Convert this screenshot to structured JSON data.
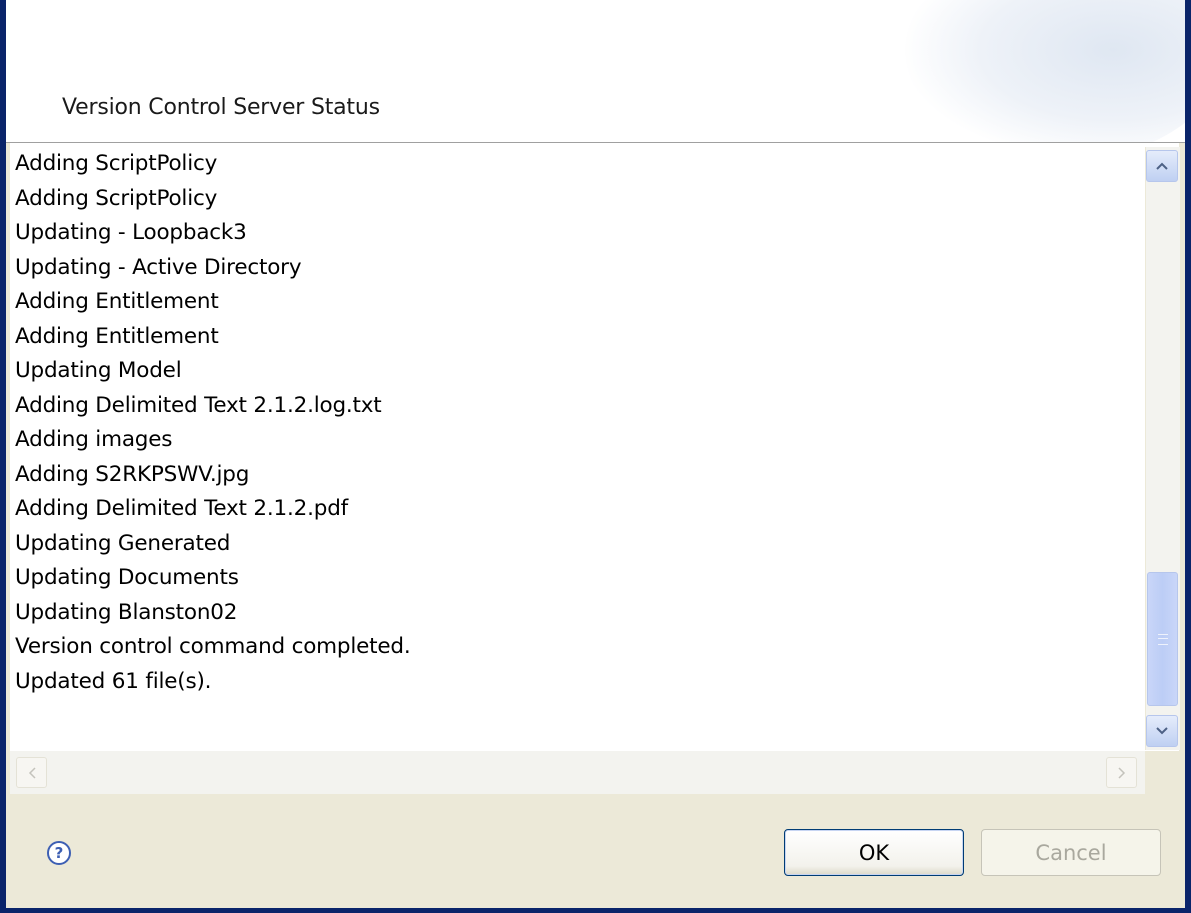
{
  "header": {
    "title": "Version Control Server Status"
  },
  "log": {
    "lines": [
      "Adding ScriptPolicy",
      "Adding ScriptPolicy",
      "Updating  - Loopback3",
      "Updating  - Active Directory",
      "Adding Entitlement",
      "Adding Entitlement",
      "Updating Model",
      "Adding Delimited Text 2.1.2.log.txt",
      "Adding images",
      "Adding S2RKPSWV.jpg",
      "Adding Delimited Text 2.1.2.pdf",
      "Updating Generated",
      "Updating Documents",
      "Updating Blanston02",
      "Version control command completed.",
      "Updated 61 file(s)."
    ]
  },
  "scrollbars": {
    "vertical_position": 1.0,
    "up_icon": "chevron-up-icon",
    "down_icon": "chevron-down-icon",
    "left_icon": "chevron-left-icon",
    "right_icon": "chevron-right-icon"
  },
  "footer": {
    "help_icon": "question-mark-icon",
    "help_glyph": "?",
    "ok_label": "OK",
    "cancel_label": "Cancel"
  },
  "colors": {
    "window_border": "#0a246a",
    "dialog_background": "#ece9d8",
    "scroll_thumb": "#bccdf6"
  }
}
